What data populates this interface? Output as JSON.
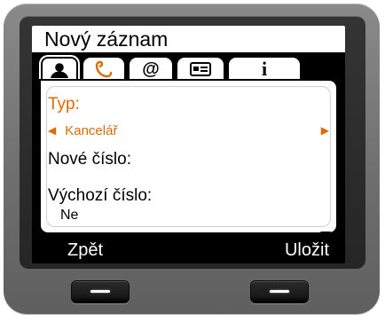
{
  "screen": {
    "title": "Nový záznam",
    "tabs": [
      {
        "icon": "person-icon"
      },
      {
        "icon": "handset-icon"
      },
      {
        "icon": "at-icon",
        "glyph": "@"
      },
      {
        "icon": "contact-card-icon"
      },
      {
        "icon": "info-icon",
        "glyph": "i"
      }
    ],
    "fields": {
      "type_label": "Typ:",
      "type_value": "Kancelář",
      "new_number_label": "Nové číslo:",
      "default_number_label": "Výchozí číslo:",
      "default_number_value": "Ne"
    },
    "softkeys": {
      "left": "Zpět",
      "right": "Uložit"
    },
    "colors": {
      "accent": "#e06a00",
      "screen_bg": "#000000",
      "panel_bg": "#ffffff"
    }
  }
}
